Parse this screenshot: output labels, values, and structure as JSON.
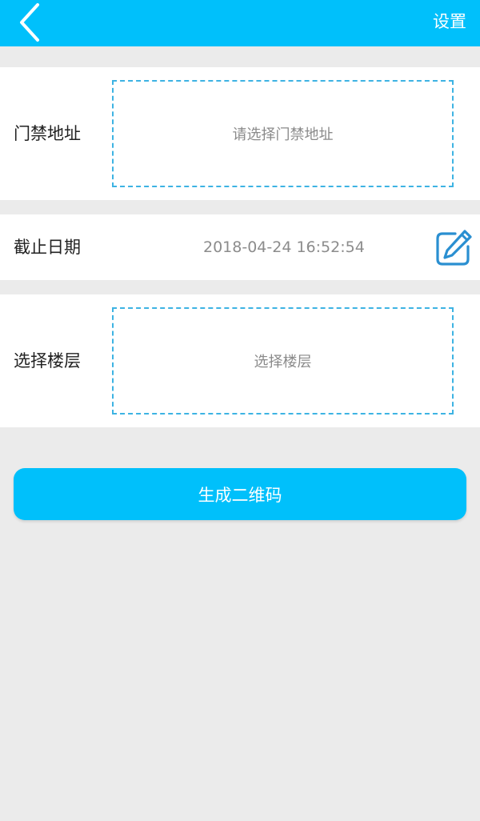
{
  "header": {
    "settings_label": "设置"
  },
  "access": {
    "label": "门禁地址",
    "placeholder": "请选择门禁地址"
  },
  "deadline": {
    "label": "截止日期",
    "value": "2018-04-24 16:52:54"
  },
  "floor": {
    "label": "选择楼层",
    "placeholder": "选择楼层"
  },
  "generate_button": {
    "label": "生成二维码"
  },
  "icons": {
    "back": "chevron-left-icon",
    "edit": "edit-pencil-icon"
  },
  "colors": {
    "primary": "#00c0fb",
    "dashed_border": "#3db3e3",
    "edit_icon": "#2a8fd1",
    "background": "#ebebeb"
  }
}
